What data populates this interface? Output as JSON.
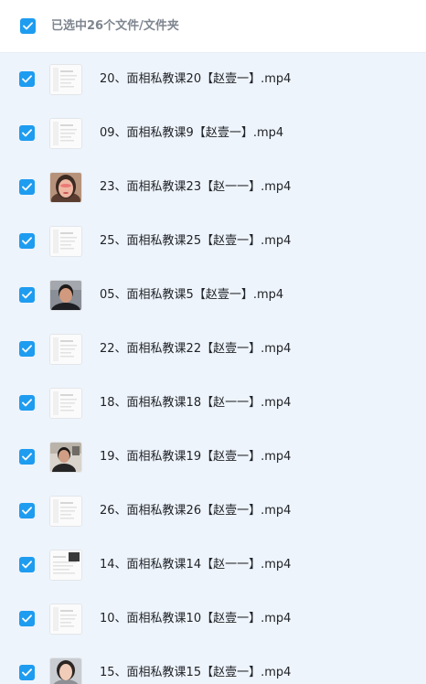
{
  "header": {
    "selection_label": "已选中26个文件/文件夹"
  },
  "files": [
    {
      "name": "20、面相私教课20【赵壹一】.mp4",
      "thumbnail": "doc",
      "selected": true
    },
    {
      "name": "09、面相私教课9【赵壹一】.mp4",
      "thumbnail": "doc",
      "selected": true
    },
    {
      "name": "23、面相私教课23【赵一一】.mp4",
      "thumbnail": "face-woman",
      "selected": true
    },
    {
      "name": "25、面相私教课25【赵壹一】.mp4",
      "thumbnail": "doc",
      "selected": true
    },
    {
      "name": "05、面相私教课5【赵壹一】.mp4",
      "thumbnail": "face-man",
      "selected": true
    },
    {
      "name": "22、面相私教课22【赵壹一】.mp4",
      "thumbnail": "doc",
      "selected": true
    },
    {
      "name": "18、面相私教课18【赵一一】.mp4",
      "thumbnail": "doc",
      "selected": true
    },
    {
      "name": "19、面相私教课19【赵壹一】.mp4",
      "thumbnail": "face-man-room",
      "selected": true
    },
    {
      "name": "26、面相私教课26【赵壹一】.mp4",
      "thumbnail": "doc",
      "selected": true
    },
    {
      "name": "14、面相私教课14【赵一一】.mp4",
      "thumbnail": "doc-photo",
      "selected": true
    },
    {
      "name": "10、面相私教课10【赵壹一】.mp4",
      "thumbnail": "doc",
      "selected": true
    },
    {
      "name": "15、面相私教课15【赵壹一】.mp4",
      "thumbnail": "face-woman-light",
      "selected": true
    }
  ],
  "colors": {
    "checkbox": "#1e9cf0",
    "background": "#eef4fb",
    "text": "#202329",
    "header_text": "#7f8690"
  }
}
